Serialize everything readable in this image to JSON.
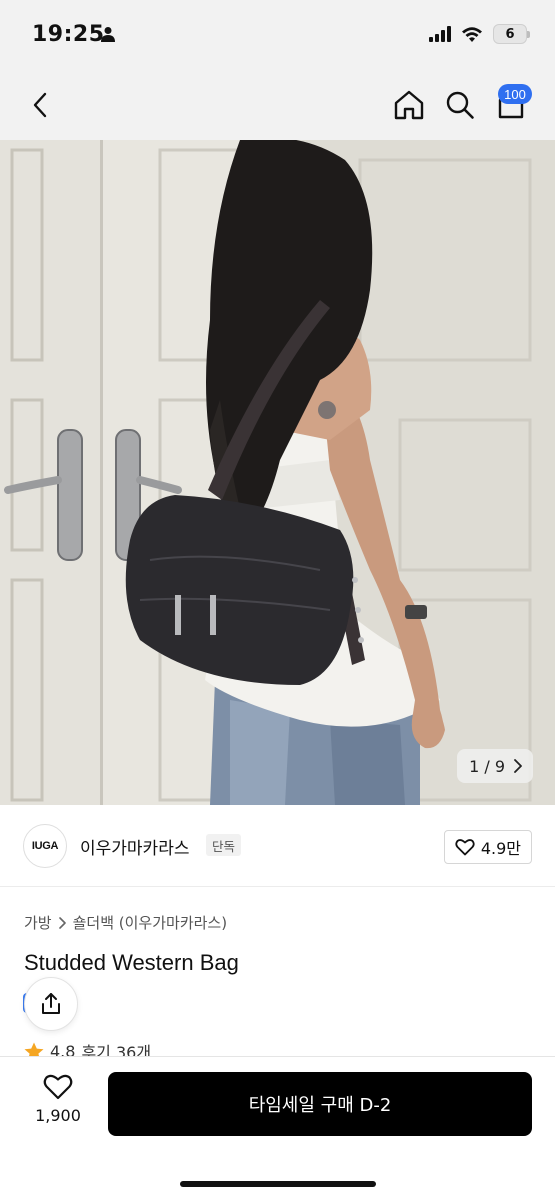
{
  "status_bar": {
    "time": "19:25",
    "battery": "6"
  },
  "nav": {
    "cart_count": "100"
  },
  "photo": {
    "counter": "1 / 9"
  },
  "brand": {
    "logo_text": "IUGA",
    "name": "이우가마카라스",
    "tag": "단독",
    "likes": "4.9만"
  },
  "product": {
    "breadcrumb": [
      "가방",
      "숄더백 (이우가마카라스)"
    ],
    "title": "Studded Western Bag",
    "rating": "4.8",
    "reviews": "후기 36개"
  },
  "bottom": {
    "wish_count": "1,900",
    "buy_label": "타임세일 구매 D-2"
  },
  "colors": {
    "accent": "#2f6ff0",
    "star": "#f5a623",
    "buy_bg": "#000000"
  }
}
